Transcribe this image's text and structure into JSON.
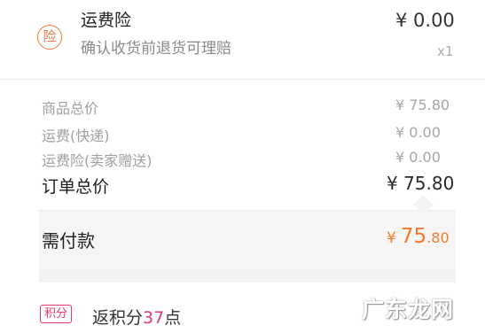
{
  "insurance": {
    "icon_char": "险",
    "title": "运费险",
    "subtitle": "确认收货前退货可理赔",
    "price": "¥ 0.00",
    "qty": "x1"
  },
  "summary": {
    "rows": [
      {
        "label": "商品总价",
        "value": "¥ 75.80"
      },
      {
        "label": "运费(快递)",
        "value": "¥ 0.00"
      },
      {
        "label": "运费险(卖家赠送)",
        "value": "¥ 0.00"
      }
    ],
    "total_label": "订单总价",
    "total_value": "¥ 75.80"
  },
  "payment": {
    "label": "需付款",
    "currency": "¥",
    "integer": "75",
    "decimal": ".80"
  },
  "points": {
    "badge": "积分",
    "prefix": "返积分",
    "number": "37",
    "suffix": "点"
  },
  "watermark": "广东龙网",
  "colors": {
    "accent_orange": "#f47a2c",
    "points_pink": "#e5376b"
  }
}
